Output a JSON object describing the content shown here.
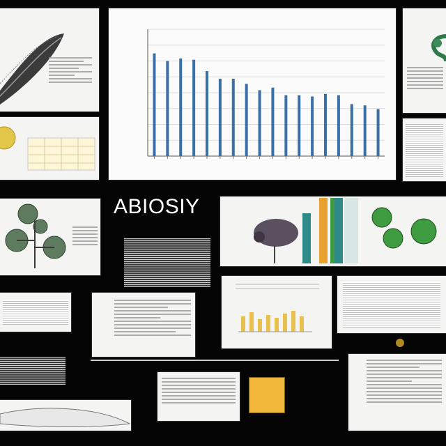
{
  "heading": "ABIOSIY",
  "chart_data": {
    "type": "bar",
    "title": "",
    "xlabel": "",
    "ylabel": "",
    "ylim": [
      0,
      10
    ],
    "color": "#3a6fa8",
    "values": [
      8.1,
      7.5,
      7.7,
      7.6,
      6.7,
      6.1,
      6.1,
      5.7,
      5.2,
      5.4,
      4.8,
      4.8,
      4.7,
      4.9,
      4.8,
      4.1,
      4.0,
      3.7
    ]
  },
  "colors": {
    "background": "#050505",
    "panel": "#f4f4f2",
    "bar": "#3a6fa8",
    "swatch": "#f0b73a",
    "plant_green": "#3f9b3f"
  }
}
